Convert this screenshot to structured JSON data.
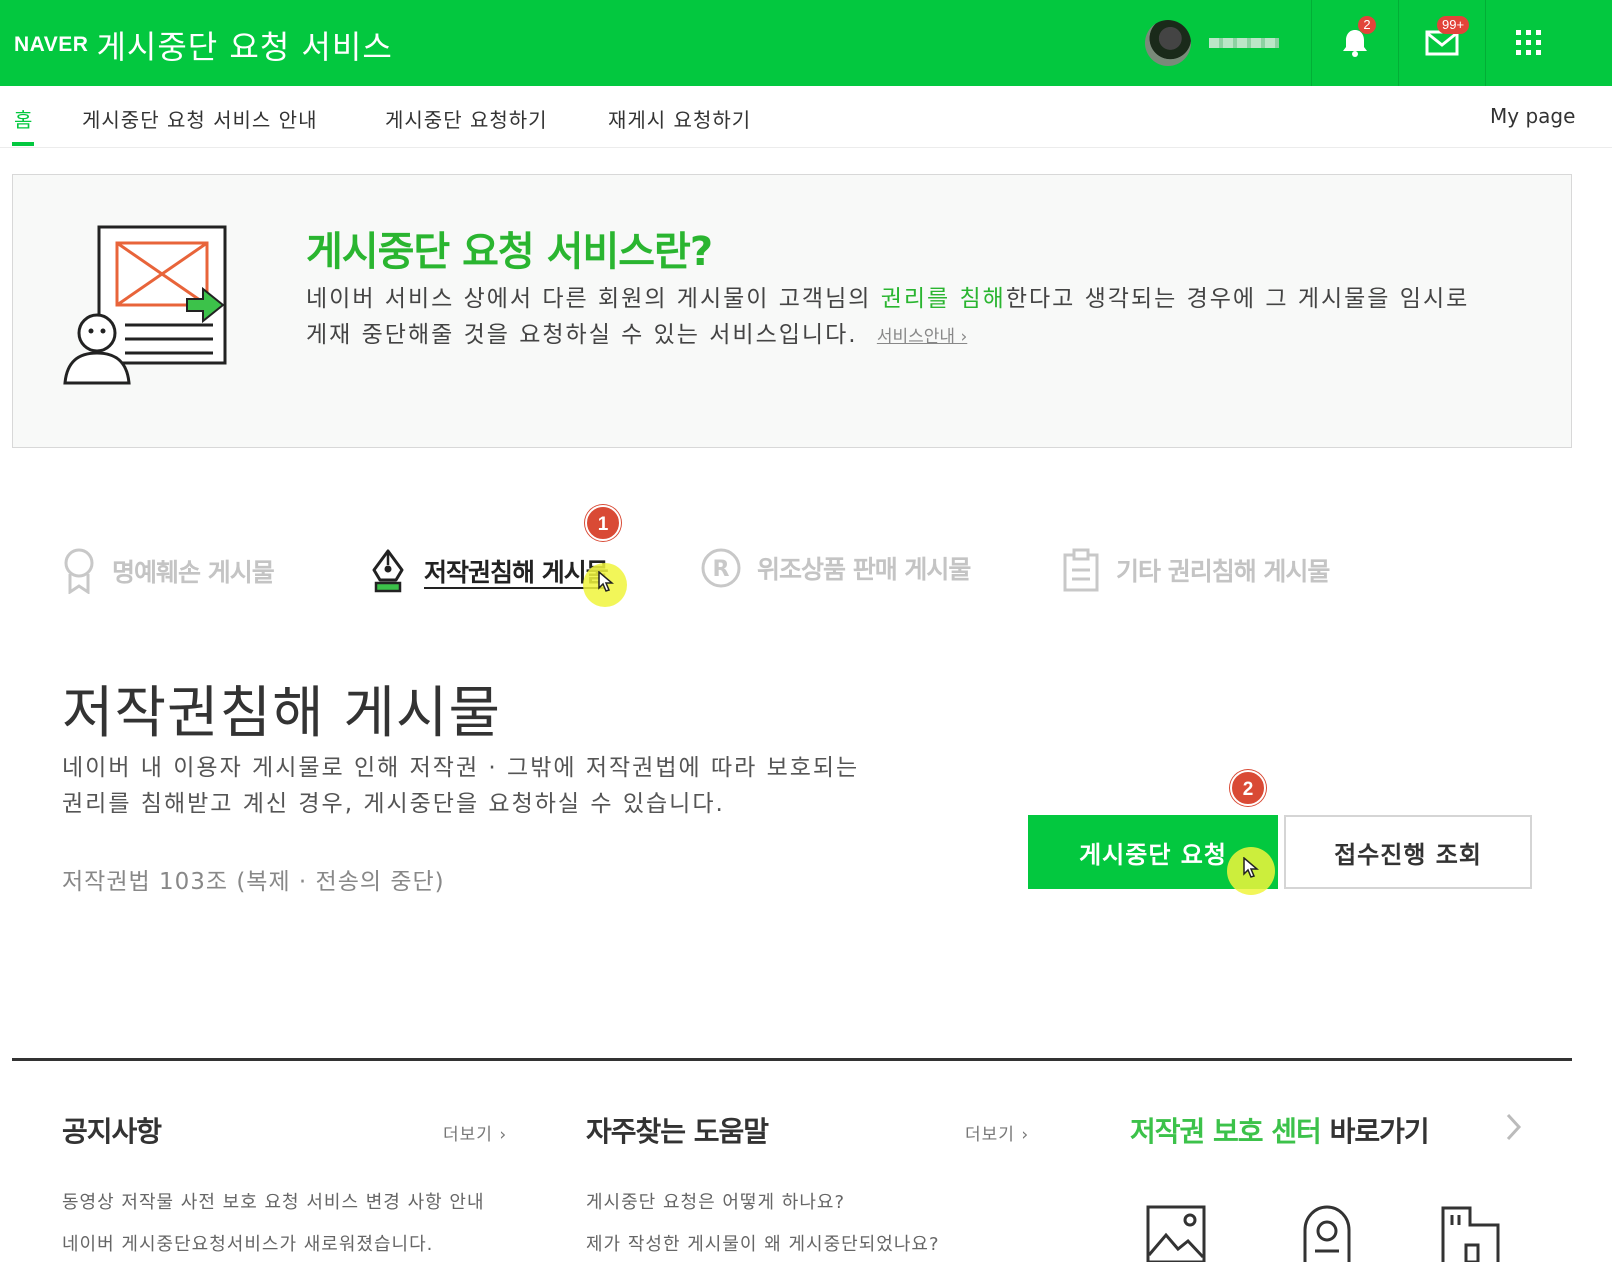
{
  "header": {
    "logo": "NAVER",
    "service_title": "게시중단 요청 서비스",
    "notification_count": "2",
    "mail_count": "99+"
  },
  "nav": {
    "items": [
      {
        "label": "홈"
      },
      {
        "label": "게시중단 요청 서비스 안내"
      },
      {
        "label": "게시중단 요청하기"
      },
      {
        "label": "재게시 요청하기"
      }
    ],
    "mypage": "My page"
  },
  "intro": {
    "title": "게시중단 요청 서비스란?",
    "desc_before": "네이버 서비스 상에서 다른 회원의 게시물이 고객님의 ",
    "desc_highlight": "권리를 침해",
    "desc_after": "한다고 생각되는 경우에 그 게시물을 임시로",
    "desc_line2": "게재 중단해줄 것을 요청하실 수 있는 서비스입니다.",
    "link": "서비스안내 ›"
  },
  "categories": [
    {
      "label": "명예훼손 게시물",
      "icon": "ribbon-icon",
      "active": false
    },
    {
      "label": "저작권침해 게시물",
      "icon": "pen-nib-icon",
      "active": true
    },
    {
      "label": "위조상품 판매 게시물",
      "icon": "registered-icon",
      "active": false
    },
    {
      "label": "기타 권리침해 게시물",
      "icon": "clipboard-icon",
      "active": false
    }
  ],
  "steps": [
    "1",
    "2"
  ],
  "section": {
    "title": "저작권침해 게시물",
    "desc_line1": "네이버 내 이용자 게시물로 인해 저작권 · 그밖에 저작권법에 따라 보호되는",
    "desc_line2": "권리를 침해받고 계신 경우, 게시중단을 요청하실 수 있습니다.",
    "law": "저작권법 103조 (복제 · 전송의 중단)",
    "primary_button": "게시중단 요청",
    "secondary_button": "접수진행 조회"
  },
  "footer": {
    "notice": {
      "title": "공지사항",
      "more": "더보기 ›",
      "items": [
        "동영상 저작물 사전 보호 요청 서비스 변경 사항 안내",
        "네이버 게시중단요청서비스가 새로워졌습니다."
      ]
    },
    "faq": {
      "title": "자주찾는 도움말",
      "more": "더보기 ›",
      "items": [
        "게시중단 요청은 어떻게 하나요?",
        "제가 작성한 게시물이 왜 게시중단되었나요?"
      ]
    },
    "protection": {
      "title_green": "저작권 보호 센터",
      "title_rest": " 바로가기"
    }
  },
  "colors": {
    "brand": "#03c83f",
    "badge": "#e2443a",
    "step_badge": "#d94a35"
  }
}
